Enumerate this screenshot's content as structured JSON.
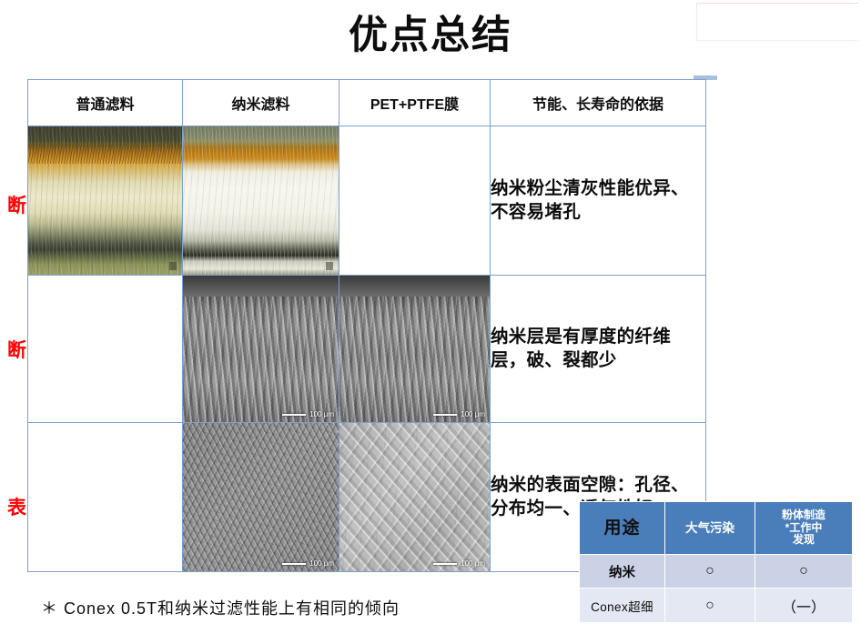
{
  "slide": {
    "title": "优点总结",
    "footnote": "＊ Conex 0.5T和纳米过滤性能上有相同的倾向",
    "accent_blue": "#4a7ebb",
    "grid_line_color": "#7ba0cd",
    "label_red": "#ff0000"
  },
  "main_table": {
    "headers": [
      "普通滤料",
      "纳米滤料",
      "PET+PTFE膜",
      "节能、长寿命的依据"
    ],
    "row_labels": [
      "断面",
      "断面",
      "表面"
    ],
    "rows": [
      {
        "label": "断面",
        "cells": [
          {
            "type": "image",
            "kind": "optical-cross-section",
            "subject": "普通滤料断面",
            "scale_label": ""
          },
          {
            "type": "image",
            "kind": "optical-cross-section",
            "subject": "纳米滤料断面",
            "scale_label": ""
          },
          {
            "type": "empty"
          }
        ],
        "description": "纳米粉尘清灰性能优异、不容易堵孔"
      },
      {
        "label": "断面",
        "cells": [
          {
            "type": "empty"
          },
          {
            "type": "image",
            "kind": "sem-cross-section",
            "subject": "纳米滤料断面 SEM",
            "scale_label": "100 μm"
          },
          {
            "type": "image",
            "kind": "sem-cross-section",
            "subject": "PET+PTFE膜断面 SEM",
            "scale_label": "100 μm"
          }
        ],
        "description": "纳米层是有厚度的纤维层，破、裂都少"
      },
      {
        "label": "表面",
        "cells": [
          {
            "type": "empty"
          },
          {
            "type": "image",
            "kind": "sem-surface",
            "subject": "纳米滤料表面 SEM",
            "scale_label": "100 μm"
          },
          {
            "type": "image",
            "kind": "sem-surface",
            "subject": "PET+PTFE膜表面 SEM",
            "scale_label": "100 μm"
          }
        ],
        "description": "纳米的表面空隙：孔径、分布均一、透气性好"
      }
    ]
  },
  "usage_table": {
    "headers": [
      "用途",
      "大气污染",
      "粉体制造\n*工作中\n发现"
    ],
    "header_col3_lines": [
      "粉体制造",
      "*工作中",
      "发现"
    ],
    "rows": [
      {
        "name": "纳米",
        "atmospheric": "○",
        "powder": "○"
      },
      {
        "name": "Conex超细",
        "atmospheric": "○",
        "powder": "（一）"
      }
    ],
    "header_bg": "#4a7ebb",
    "row0_bg": "#ccd2e6",
    "row1_bg": "#e4e8f2"
  }
}
